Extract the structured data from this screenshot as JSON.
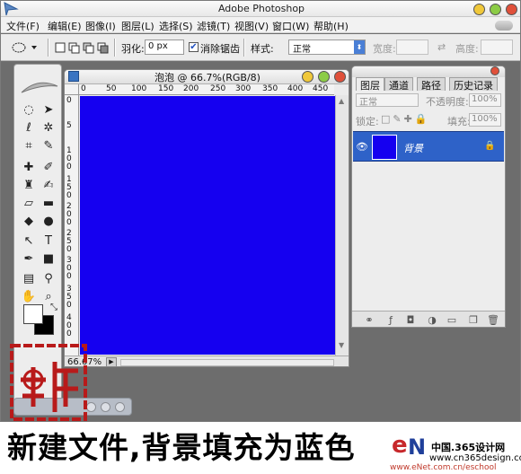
{
  "app": {
    "title": "Adobe Photoshop"
  },
  "menubar": {
    "items": [
      "文件(F)",
      "编辑(E)",
      "图像(I)",
      "图层(L)",
      "选择(S)",
      "滤镜(T)",
      "视图(V)",
      "窗口(W)",
      "帮助(H)"
    ]
  },
  "options": {
    "feather_label": "羽化:",
    "feather_value": "0 px",
    "antialias_label": "消除锯齿",
    "style_label": "样式:",
    "style_value": "正常",
    "width_label": "宽度:",
    "height_label": "高度:"
  },
  "document": {
    "title": "泡泡 @ 66.7%(RGB/8)",
    "zoom": "66.67%",
    "fill_color": "#1500f0",
    "ruler_top": [
      "0",
      "50",
      "100",
      "150",
      "200",
      "250",
      "300",
      "350",
      "400",
      "450"
    ],
    "ruler_left": [
      "0",
      "5",
      "1\n0\n0",
      "1\n5\n0",
      "2\n0\n0",
      "2\n5\n0",
      "3\n0\n0",
      "3\n5\n0",
      "4\n0\n0"
    ]
  },
  "layers_panel": {
    "tabs": [
      "图层",
      "通道",
      "路径",
      "历史记录"
    ],
    "blend_mode": "正常",
    "opacity_label": "不透明度:",
    "opacity_value": "100%",
    "lock_label": "锁定:",
    "fill_label": "填充:",
    "fill_value": "100%",
    "layer_name": "背景"
  },
  "caption": {
    "text": "新建文件,背景填充为蓝色"
  },
  "watermark": {
    "line1": "中国.365设计网",
    "line2": "www.cn365design.com",
    "line3": "www.eNet.com.cn/eschool"
  },
  "colors": {
    "accent_blue": "#2e62c8",
    "canvas_blue": "#1500f0",
    "workspace_gray": "#6d6d6d"
  }
}
